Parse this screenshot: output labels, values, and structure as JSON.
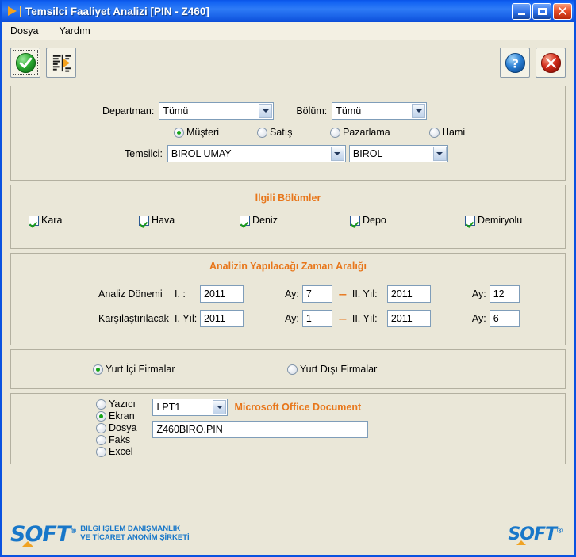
{
  "window": {
    "title": "Temsilci Faaliyet Analizi [PIN - Z460]",
    "app_icon": "orange-triangle-icon",
    "minimize_label": "_",
    "maximize_label": "□",
    "close_label": "✕"
  },
  "menu": {
    "items": [
      {
        "label": "Dosya"
      },
      {
        "label": "Yardım"
      }
    ]
  },
  "toolbar": {
    "left": [
      {
        "name": "ok-button",
        "icon": "green-check-icon"
      },
      {
        "name": "report-button",
        "icon": "report-list-icon"
      }
    ],
    "right": [
      {
        "name": "help-button",
        "icon": "blue-question-icon"
      },
      {
        "name": "close-button",
        "icon": "red-x-icon"
      }
    ]
  },
  "filters": {
    "department_label": "Departman:",
    "department_value": "Tümü",
    "section_label": "Bölüm:",
    "section_value": "Tümü",
    "type_options": [
      {
        "label": "Müşteri",
        "selected": true
      },
      {
        "label": "Satış",
        "selected": false
      },
      {
        "label": "Pazarlama",
        "selected": false
      },
      {
        "label": "Hami",
        "selected": false
      }
    ],
    "rep_label": "Temsilci:",
    "rep_value": "BIROL UMAY",
    "rep_code_value": "BIROL"
  },
  "sections": {
    "title": "İlgili Bölümler",
    "items": [
      {
        "label": "Kara",
        "checked": true
      },
      {
        "label": "Hava",
        "checked": true
      },
      {
        "label": "Deniz",
        "checked": true
      },
      {
        "label": "Depo",
        "checked": true
      },
      {
        "label": "Demiryolu",
        "checked": true
      }
    ]
  },
  "period": {
    "title": "Analizin Yapılacağı Zaman Aralığı",
    "rows": [
      {
        "label": "Analiz Dönemi",
        "first_label": "I. :",
        "first_year": "2011",
        "month_label_1": "Ay:",
        "first_month": "7",
        "separator": "---",
        "second_label": "II. Yıl:",
        "second_year": "2011",
        "month_label_2": "Ay:",
        "second_month": "12"
      },
      {
        "label": "Karşılaştırılacak",
        "first_label": "I. Yıl:",
        "first_year": "2011",
        "month_label_1": "Ay:",
        "first_month": "1",
        "separator": "---",
        "second_label": "II. Yıl:",
        "second_year": "2011",
        "month_label_2": "Ay:",
        "second_month": "6"
      }
    ]
  },
  "firms": {
    "options": [
      {
        "label": "Yurt İçi Firmalar",
        "selected": true
      },
      {
        "label": "Yurt Dışı Firmalar",
        "selected": false
      }
    ]
  },
  "output": {
    "options": [
      {
        "label": "Yazıcı",
        "selected": false
      },
      {
        "label": "Ekran",
        "selected": true
      },
      {
        "label": "Dosya",
        "selected": false
      },
      {
        "label": "Faks",
        "selected": false
      },
      {
        "label": "Excel",
        "selected": false
      }
    ],
    "port_value": "LPT1",
    "printer_name": "Microsoft Office Document",
    "file_value": "Z460BIRO.PIN"
  },
  "footer": {
    "logo_text": "SOFT",
    "logo_reg": "®",
    "company_line1": "BİLGİ İŞLEM DANIŞMANLIK",
    "company_line2": "VE TİCARET ANONİM ŞİRKETİ",
    "logo_text_right": "SOFT",
    "logo_reg_right": "®"
  },
  "colors": {
    "accent_orange": "#E8761A",
    "panel_bg": "#EAE7D8",
    "title_blue": "#1162F2",
    "logo_blue": "#1877C9"
  }
}
